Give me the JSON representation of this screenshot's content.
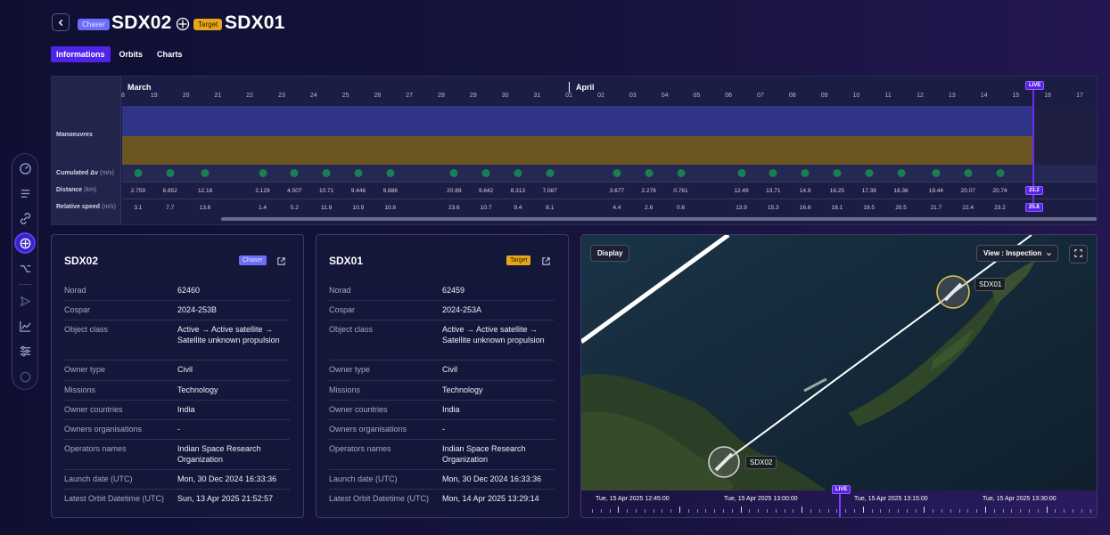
{
  "header": {
    "chaser_badge": "Chaser",
    "chaser_name": "SDX02",
    "target_badge": "Target",
    "target_name": "SDX01"
  },
  "tabs": [
    {
      "label": "Informations",
      "active": true
    },
    {
      "label": "Orbits",
      "active": false
    },
    {
      "label": "Charts",
      "active": false
    }
  ],
  "sidebar": {
    "icons": [
      "dashboard-icon",
      "list-icon",
      "link-icon",
      "crosshair-icon",
      "orbit-branch-icon",
      "send-icon",
      "chart-icon",
      "sliders-icon",
      "circle-icon"
    ]
  },
  "timeline": {
    "months": [
      "March",
      "April"
    ],
    "days": [
      "8",
      "19",
      "20",
      "21",
      "22",
      "23",
      "24",
      "25",
      "26",
      "27",
      "28",
      "29",
      "30",
      "31",
      "01",
      "02",
      "03",
      "04",
      "05",
      "06",
      "07",
      "08",
      "09",
      "10",
      "11",
      "12",
      "13",
      "14",
      "15",
      "16",
      "17"
    ],
    "rows": {
      "manoeuvres": "Manoeuvres",
      "cumulated_dv": {
        "label": "Cumulated Δv",
        "unit": "(m/s)"
      },
      "distance": {
        "label": "Distance",
        "unit": "(km)"
      },
      "relative_speed": {
        "label": "Relative speed",
        "unit": "(m/s)"
      }
    },
    "live_label": "LIVE",
    "distance_values": [
      "2.759",
      "6.852",
      "12.18",
      "2.129",
      "4.507",
      "10.71",
      "9.448",
      "9.886",
      "20.89",
      "9.842",
      "8.313",
      "7.087",
      "3.677",
      "2.276",
      "0.761",
      "12.49",
      "13.71",
      "14.9",
      "16.25",
      "17.38",
      "18.36",
      "19.44",
      "20.07",
      "20.74"
    ],
    "distance_live": "23.2",
    "speed_values": [
      "3.1",
      "7.7",
      "13.6",
      "1.4",
      "5.2",
      "11.8",
      "10.9",
      "10.8",
      "23.6",
      "10.7",
      "9.4",
      "8.1",
      "4.4",
      "2.6",
      "0.6",
      "13.9",
      "15.3",
      "16.6",
      "18.1",
      "19.5",
      "20.5",
      "21.7",
      "22.4",
      "23.2"
    ],
    "speed_live": "25.8"
  },
  "chaser_card": {
    "title": "SDX02",
    "badge": "Chaser",
    "rows": [
      {
        "k": "Norad",
        "v": "62460"
      },
      {
        "k": "Cospar",
        "v": "2024-253B"
      },
      {
        "k": "Object class",
        "v": "Active → Active satellite → Satellite unknown propulsion"
      },
      {
        "k": "Owner type",
        "v": "Civil"
      },
      {
        "k": "Missions",
        "v": "Technology"
      },
      {
        "k": "Owner countries",
        "v": "India"
      },
      {
        "k": "Owners organisations",
        "v": "-"
      },
      {
        "k": "Operators names",
        "v": "Indian Space Research Organization"
      },
      {
        "k": "Launch date (UTC)",
        "v": "Mon, 30 Dec 2024 16:33:36"
      },
      {
        "k": "Latest Orbit Datetime (UTC)",
        "v": "Sun, 13 Apr 2025 21:52:57"
      }
    ]
  },
  "target_card": {
    "title": "SDX01",
    "badge": "Target",
    "rows": [
      {
        "k": "Norad",
        "v": "62459"
      },
      {
        "k": "Cospar",
        "v": "2024-253A"
      },
      {
        "k": "Object class",
        "v": "Active → Active satellite → Satellite unknown propulsion"
      },
      {
        "k": "Owner type",
        "v": "Civil"
      },
      {
        "k": "Missions",
        "v": "Technology"
      },
      {
        "k": "Owner countries",
        "v": "India"
      },
      {
        "k": "Owners organisations",
        "v": "-"
      },
      {
        "k": "Operators names",
        "v": "Indian Space Research Organization"
      },
      {
        "k": "Launch date (UTC)",
        "v": "Mon, 30 Dec 2024 16:33:36"
      },
      {
        "k": "Latest Orbit Datetime (UTC)",
        "v": "Mon, 14 Apr 2025 13:29:14"
      }
    ]
  },
  "map": {
    "display_button": "Display",
    "view_select": "View : Inspection",
    "sat_chaser": "SDX02",
    "sat_target": "SDX01",
    "live_label": "LIVE",
    "time_labels": [
      "Tue, 15 Apr 2025 12:45:00",
      "Tue, 15 Apr 2025 13:00:00",
      "Tue, 15 Apr 2025 13:15:00",
      "Tue, 15 Apr 2025 13:30:00"
    ]
  },
  "colors": {
    "accent": "#4f23e8",
    "chaser": "#6a6ef8",
    "target": "#e6a817",
    "manoeuvre_band1": "#2f3486",
    "manoeuvre_band2": "#6b5523",
    "dv_dot": "#17804c"
  }
}
